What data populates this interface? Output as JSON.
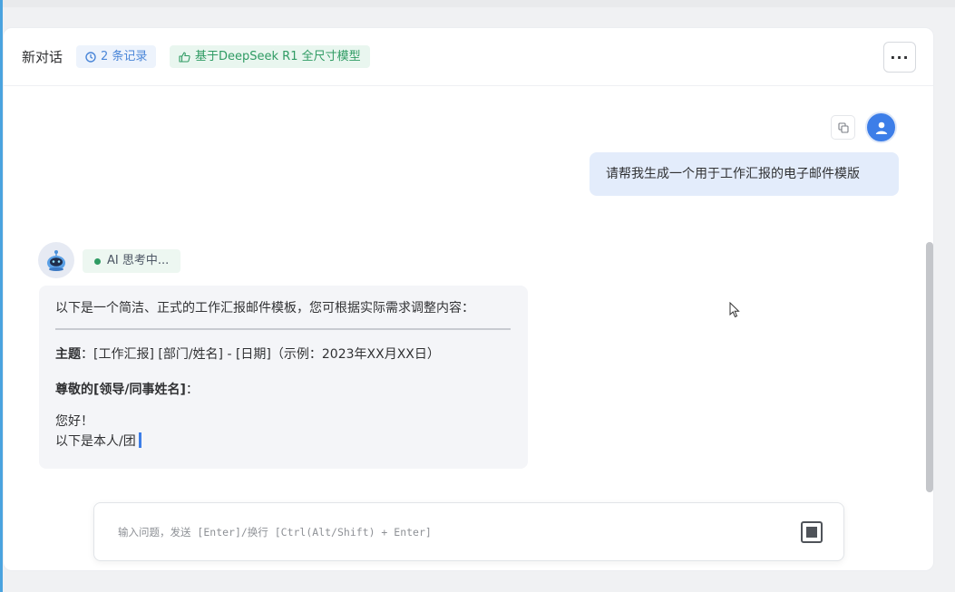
{
  "header": {
    "title": "新对话",
    "records_label": "2 条记录",
    "model_label": "基于DeepSeek R1 全尺寸模型",
    "more_label": "···"
  },
  "icons": {
    "records": "clock-icon",
    "model": "thumbs-up-icon",
    "more": "more-horizontal-icon",
    "copy": "copy-icon",
    "user_avatar": "user-icon",
    "ai_avatar": "robot-icon",
    "stop": "stop-icon"
  },
  "messages": {
    "user": {
      "text": "请帮我生成一个用于工作汇报的电子邮件模版"
    },
    "ai": {
      "status": "AI 思考中...",
      "intro": "以下是一个简洁、正式的工作汇报邮件模板，您可根据实际需求调整内容：",
      "subject_label": "主题",
      "subject_text": "：[工作汇报] [部门/姓名] - [日期]（示例：2023年XX月XX日）",
      "salutation_bold": "尊敬的[领导/同事姓名]",
      "salutation_tail": "：",
      "greeting": "您好！",
      "partial": "以下是本人/团"
    }
  },
  "input": {
    "placeholder": "输入问题，发送 [Enter]/换行 [Ctrl(Alt/Shift) + Enter]"
  },
  "colors": {
    "accent": "#3d7ee8",
    "user_bubble": "#e3ecfb",
    "ai_bubble": "#f4f5f8",
    "status_green": "#2f9b63",
    "records_badge_text": "#4a86d8"
  }
}
